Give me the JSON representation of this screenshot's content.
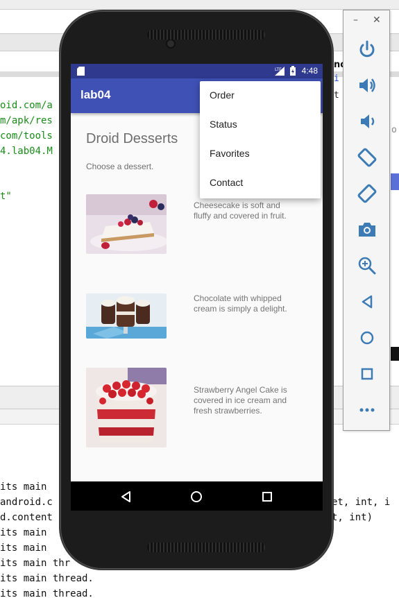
{
  "ide": {
    "code_lines": [
      "oid.com/a",
      "m/apk/res",
      "com/tools",
      "4.lab04.M",
      "t\""
    ],
    "log_lines": [
      "its main",
      "android.c",
      "d.content",
      "its main",
      "its main",
      "its main thr",
      "its main thread.",
      "its main thread."
    ],
    "right_fragments": {
      "nd": "nd",
      "i": "i",
      "t": "t",
      "o": "o",
      "et": "et, int, i",
      "int": "t, int)"
    }
  },
  "phone": {
    "status_time": "4:48",
    "app_title": "lab04",
    "heading": "Droid Desserts",
    "subheading": "Choose a dessert.",
    "desserts": [
      {
        "name": "cheesecake",
        "description": "Cheesecake is soft and fluffy and covered in fruit."
      },
      {
        "name": "chocolate",
        "description": "Chocolate with whipped cream is simply a delight."
      },
      {
        "name": "strawberry",
        "description": "Strawberry Angel Cake is covered in ice cream and fresh strawberries."
      }
    ],
    "menu": {
      "items": [
        "Order",
        "Status",
        "Favorites",
        "Contact"
      ]
    },
    "fab_icon": "mail-icon",
    "colors": {
      "primary": "#3f51b5",
      "primary_dark": "#2f3a8f",
      "accent": "#ff4081"
    }
  },
  "emulator": {
    "minimize": "–",
    "close": "✕",
    "buttons": [
      "power-icon",
      "volume-up-icon",
      "volume-down-icon",
      "rotate-left-icon",
      "rotate-right-icon",
      "camera-icon",
      "zoom-icon",
      "back-icon",
      "home-icon",
      "overview-icon",
      "more-icon"
    ]
  }
}
